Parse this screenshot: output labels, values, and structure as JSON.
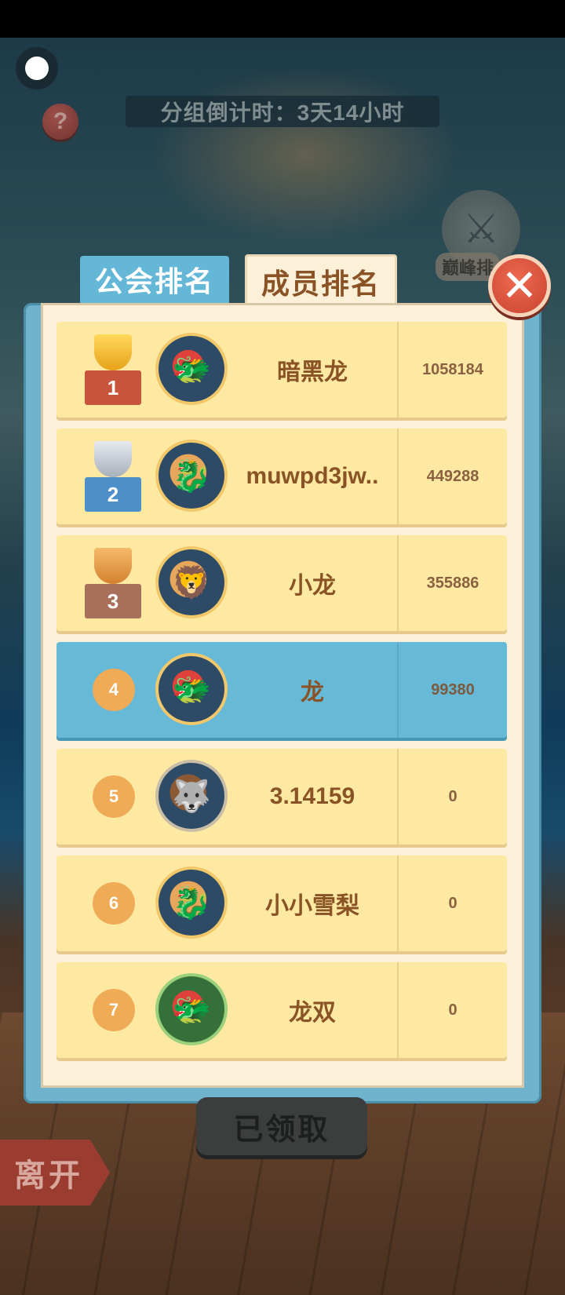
{
  "header": {
    "countdown": "分组倒计时：3天14小时",
    "help_symbol": "?",
    "peak_label": "巅峰排"
  },
  "tabs": [
    {
      "label": "公会排名",
      "active": false
    },
    {
      "label": "成员排名",
      "active": true
    }
  ],
  "close_symbol": "✕",
  "rankings": [
    {
      "rank": "1",
      "name": "暗黑龙",
      "score": "1058184",
      "trophy": "gold"
    },
    {
      "rank": "2",
      "name": "muwpd3jw..",
      "score": "449288",
      "trophy": "silver"
    },
    {
      "rank": "3",
      "name": "小龙",
      "score": "355886",
      "trophy": "bronze"
    },
    {
      "rank": "4",
      "name": "龙",
      "score": "99380",
      "highlight": true
    },
    {
      "rank": "5",
      "name": "3.14159",
      "score": "0"
    },
    {
      "rank": "6",
      "name": "小小雪梨",
      "score": "0"
    },
    {
      "rank": "7",
      "name": "龙双",
      "score": "0"
    }
  ],
  "buttons": {
    "claimed": "已领取",
    "leave": "离开"
  },
  "colors": {
    "row_bg": "#fee9a3",
    "highlight_bg": "#66b9d7",
    "tab_inactive": "#64b7d6",
    "close_red": "#e2553f",
    "text_brown": "#8a5326"
  }
}
